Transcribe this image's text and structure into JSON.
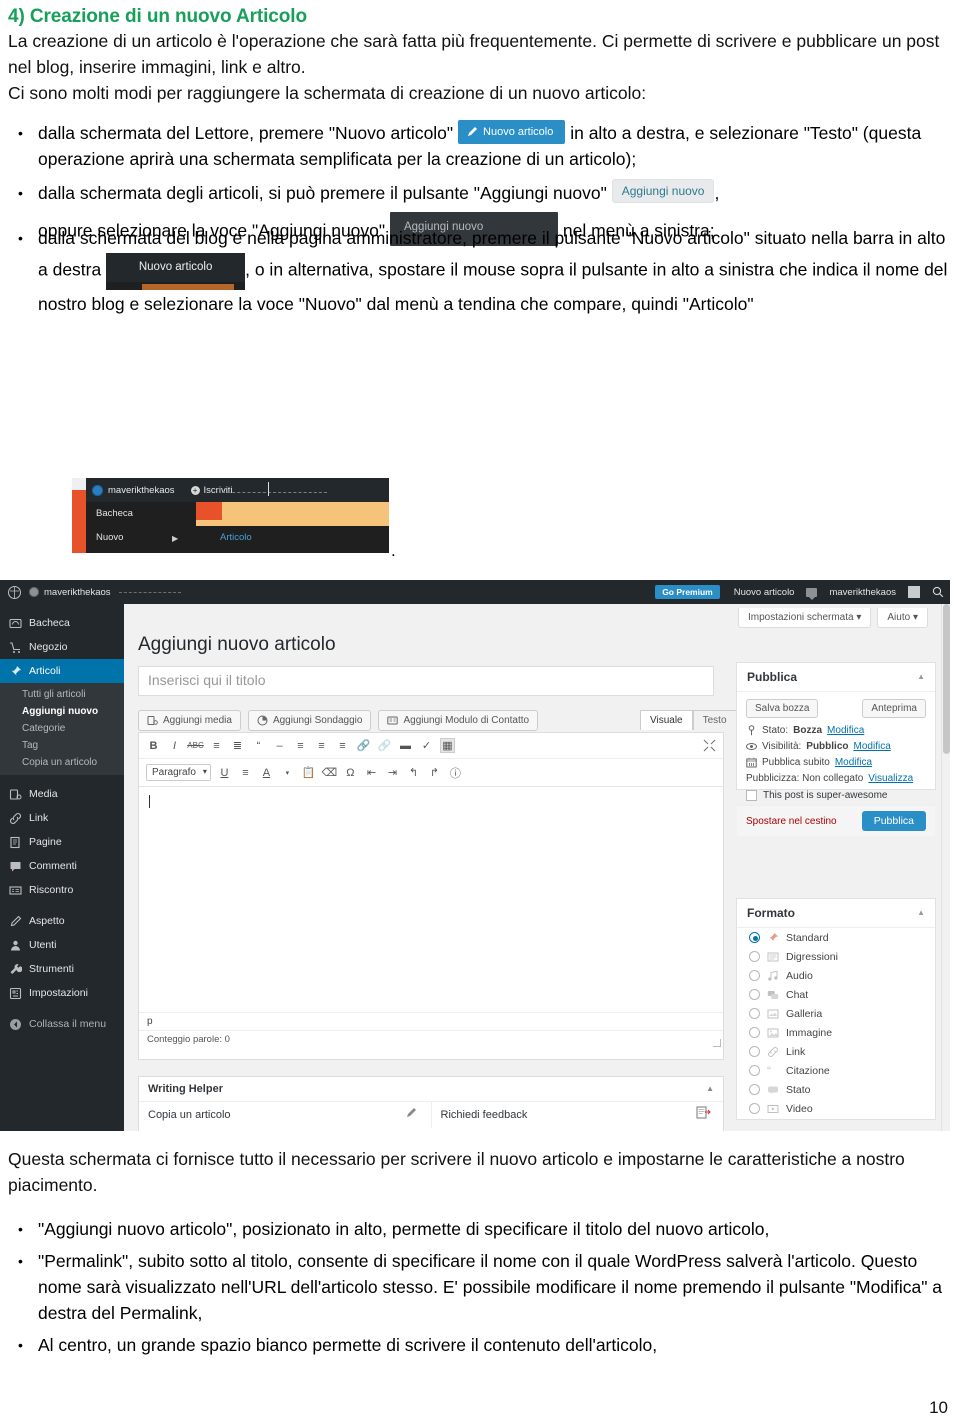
{
  "document": {
    "heading": "4) Creazione di un nuovo Articolo",
    "intro": "La creazione di un articolo è l'operazione che sarà fatta più frequentemente. Ci permette di scrivere e pubblicare un post nel blog, inserire immagini, link e altro.",
    "ways_intro": "Ci sono molti modi per raggiungere la schermata di creazione di un nuovo articolo:",
    "bullets": {
      "b1_a": "dalla schermata del Lettore, premere \"Nuovo articolo\"",
      "b1_b": "in alto a destra, e selezionare \"Testo\" (questa operazione aprirà una schermata semplificata per la creazione di un articolo);",
      "b2_a": "dalla schermata degli articoli, si può premere il pulsante \"Aggiungi nuovo\"",
      "b2_comma": ",",
      "b2_b": "oppure selezionare la voce \"Aggiungi nuovo\"",
      "b2_c": "nel menù a sinistra;",
      "b3_a": "dalla schermata del blog e nella pagina amministratore, premere il pulsante \"Nuovo articolo\" situato nella barra in alto a destra",
      "b3_b": ", o in alternativa, spostare il mouse sopra il pulsante in alto a sinistra che indica il nome del nostro blog e selezionare la voce \"Nuovo\" dal menù a tendina che compare, quindi \"Articolo\""
    },
    "period": ".",
    "closing": "Questa schermata ci fornisce tutto il necessario per scrivere il nuovo articolo e impostarne le caratteristiche a nostro piacimento.",
    "tail_bullets": [
      "\"Aggiungi nuovo articolo\", posizionato in alto, permette di specificare il titolo del nuovo articolo,",
      "\"Permalink\", subito sotto al titolo, consente di specificare il nome con il quale WordPress salverà l'articolo. Questo nome sarà visualizzato nell'URL dell'articolo stesso. E' possibile modificare il nome premendo il pulsante \"Modifica\" a destra del Permalink,",
      "Al centro, un grande spazio bianco permette di scrivere il contenuto dell'articolo,"
    ],
    "page_number": "10",
    "heading_color": "#17a05a"
  },
  "inline_buttons": {
    "nuovo_articolo_blue": "Nuovo articolo",
    "nuovo_articolo_blue_color": "#2b8fc7",
    "aggiungi_nuovo_gray": "Aggiungi nuovo",
    "aggiungi_nuovo_dark": "Aggiungi nuovo",
    "nuovo_articolo_bar": "Nuovo articolo"
  },
  "mini_screenshot": {
    "site_name": "maverikthekaos",
    "subscribe": "Iscriviti",
    "menu_bacheca": "Bacheca",
    "menu_nuovo": "Nuovo",
    "submenu_articolo": "Articolo"
  },
  "wp_admin": {
    "adminbar": {
      "site_name": "maverikthekaos",
      "go_premium": "Go Premium",
      "new_post": "Nuovo articolo",
      "user": "maverikthekaos"
    },
    "sidebar": [
      {
        "label": "Bacheca",
        "icon": "dashboard-icon"
      },
      {
        "label": "Negozio",
        "icon": "cart-icon"
      },
      {
        "label": "Articoli",
        "icon": "pin-icon",
        "active": true
      },
      {
        "label": "Media",
        "icon": "media-icon"
      },
      {
        "label": "Link",
        "icon": "link-icon"
      },
      {
        "label": "Pagine",
        "icon": "pages-icon"
      },
      {
        "label": "Commenti",
        "icon": "comment-icon"
      },
      {
        "label": "Riscontro",
        "icon": "feedback-icon"
      },
      {
        "label": "Aspetto",
        "icon": "appearance-icon"
      },
      {
        "label": "Utenti",
        "icon": "users-icon"
      },
      {
        "label": "Strumenti",
        "icon": "tools-icon"
      },
      {
        "label": "Impostazioni",
        "icon": "settings-icon"
      },
      {
        "label": "Collassa il menu",
        "icon": "collapse-icon"
      }
    ],
    "submenu": [
      "Tutti gli articoli",
      "Aggiungi nuovo",
      "Categorie",
      "Tag",
      "Copia un articolo"
    ],
    "submenu_current": "Aggiungi nuovo",
    "screen_tabs": [
      "Impostazioni schermata",
      "Aiuto"
    ],
    "page_title": "Aggiungi nuovo articolo",
    "title_placeholder": "Inserisci qui il titolo",
    "media_buttons": [
      "Aggiungi media",
      "Aggiungi Sondaggio",
      "Aggiungi Modulo di Contatto"
    ],
    "editor_tabs": [
      "Visuale",
      "Testo"
    ],
    "format_select": "Paragrafo",
    "status_tag": "p",
    "word_count": "Conteggio parole: 0",
    "writing_helper": {
      "title": "Writing Helper",
      "left": "Copia un articolo",
      "right": "Richiedi feedback"
    },
    "publish": {
      "title": "Pubblica",
      "save_draft": "Salva bozza",
      "preview": "Anteprima",
      "status_label": "Stato:",
      "status_value": "Bozza",
      "status_edit": "Modifica",
      "visibility_label": "Visibilità:",
      "visibility_value": "Pubblico",
      "visibility_edit": "Modifica",
      "publish_now_label": "Pubblica subito",
      "publish_now_edit": "Modifica",
      "publicize_label": "Pubblicizza: Non collegato",
      "publicize_link": "Visualizza",
      "checkbox_label": "This post is super-awesome",
      "trash": "Spostare nel cestino",
      "publish_button": "Pubblica",
      "accent": "#2b8fc7"
    },
    "formato": {
      "title": "Formato",
      "options": [
        {
          "label": "Standard",
          "selected": true
        },
        {
          "label": "Digressioni",
          "selected": false
        },
        {
          "label": "Audio",
          "selected": false
        },
        {
          "label": "Chat",
          "selected": false
        },
        {
          "label": "Galleria",
          "selected": false
        },
        {
          "label": "Immagine",
          "selected": false
        },
        {
          "label": "Link",
          "selected": false
        },
        {
          "label": "Citazione",
          "selected": false
        },
        {
          "label": "Stato",
          "selected": false
        },
        {
          "label": "Video",
          "selected": false
        }
      ]
    }
  }
}
